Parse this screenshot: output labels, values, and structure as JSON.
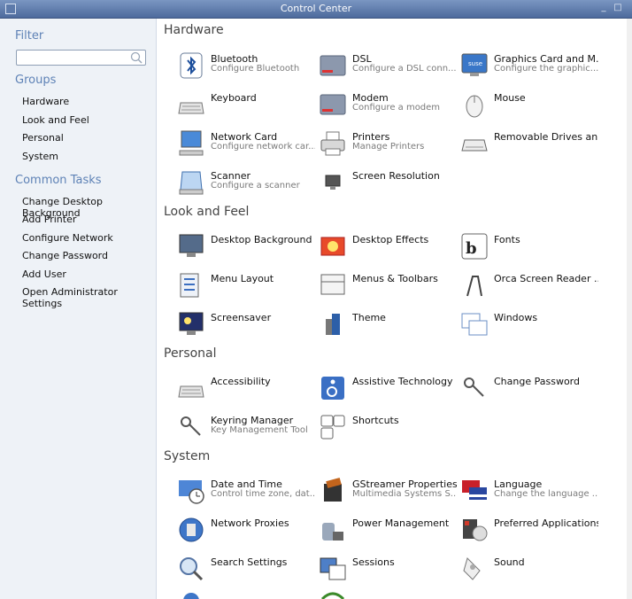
{
  "window": {
    "title": "Control Center",
    "minimize": "_",
    "maximize": "□"
  },
  "sidebar": {
    "filter_heading": "Filter",
    "filter_placeholder": "",
    "groups_heading": "Groups",
    "groups": [
      "Hardware",
      "Look and Feel",
      "Personal",
      "System"
    ],
    "tasks_heading": "Common Tasks",
    "tasks": [
      "Change Desktop Background",
      "Add Printer",
      "Configure Network",
      "Change Password",
      "Add User",
      "Open Administrator Settings"
    ]
  },
  "sections": {
    "hardware": "Hardware",
    "look": "Look and Feel",
    "personal": "Personal",
    "system": "System"
  },
  "items": {
    "bluetooth": {
      "name": "Bluetooth",
      "desc": "Configure Bluetooth"
    },
    "dsl": {
      "name": "DSL",
      "desc": "Configure a DSL conn..."
    },
    "graphics": {
      "name": "Graphics Card and M...",
      "desc": "Configure the graphic..."
    },
    "keyboard": {
      "name": "Keyboard",
      "desc": ""
    },
    "modem": {
      "name": "Modem",
      "desc": "Configure a modem"
    },
    "mouse": {
      "name": "Mouse",
      "desc": ""
    },
    "network_card": {
      "name": "Network Card",
      "desc": "Configure network car..."
    },
    "printers": {
      "name": "Printers",
      "desc": "Manage Printers"
    },
    "removable": {
      "name": "Removable Drives an...",
      "desc": ""
    },
    "scanner": {
      "name": "Scanner",
      "desc": "Configure a scanner"
    },
    "screen_res": {
      "name": "Screen Resolution",
      "desc": ""
    },
    "desktop_bg": {
      "name": "Desktop Background",
      "desc": ""
    },
    "desktop_fx": {
      "name": "Desktop Effects",
      "desc": ""
    },
    "fonts": {
      "name": "Fonts",
      "desc": ""
    },
    "menu_layout": {
      "name": "Menu Layout",
      "desc": ""
    },
    "menus_toolbars": {
      "name": "Menus & Toolbars",
      "desc": ""
    },
    "orca": {
      "name": "Orca Screen Reader ...",
      "desc": ""
    },
    "screensaver": {
      "name": "Screensaver",
      "desc": ""
    },
    "theme": {
      "name": "Theme",
      "desc": ""
    },
    "windows": {
      "name": "Windows",
      "desc": ""
    },
    "accessibility": {
      "name": "Accessibility",
      "desc": ""
    },
    "assistive": {
      "name": "Assistive Technology ...",
      "desc": ""
    },
    "change_password": {
      "name": "Change Password",
      "desc": ""
    },
    "keyring": {
      "name": "Keyring Manager",
      "desc": "Key Management Tool"
    },
    "shortcuts": {
      "name": "Shortcuts",
      "desc": ""
    },
    "datetime": {
      "name": "Date and Time",
      "desc": "Control time zone, dat..."
    },
    "gstreamer": {
      "name": "GStreamer Properties",
      "desc": "Multimedia Systems S..."
    },
    "language": {
      "name": "Language",
      "desc": "Change the language ..."
    },
    "proxies": {
      "name": "Network Proxies",
      "desc": ""
    },
    "power": {
      "name": "Power Management",
      "desc": ""
    },
    "preferred_apps": {
      "name": "Preferred Applications",
      "desc": ""
    },
    "search": {
      "name": "Search Settings",
      "desc": ""
    },
    "sessions": {
      "name": "Sessions",
      "desc": ""
    },
    "sound": {
      "name": "Sound",
      "desc": ""
    }
  }
}
